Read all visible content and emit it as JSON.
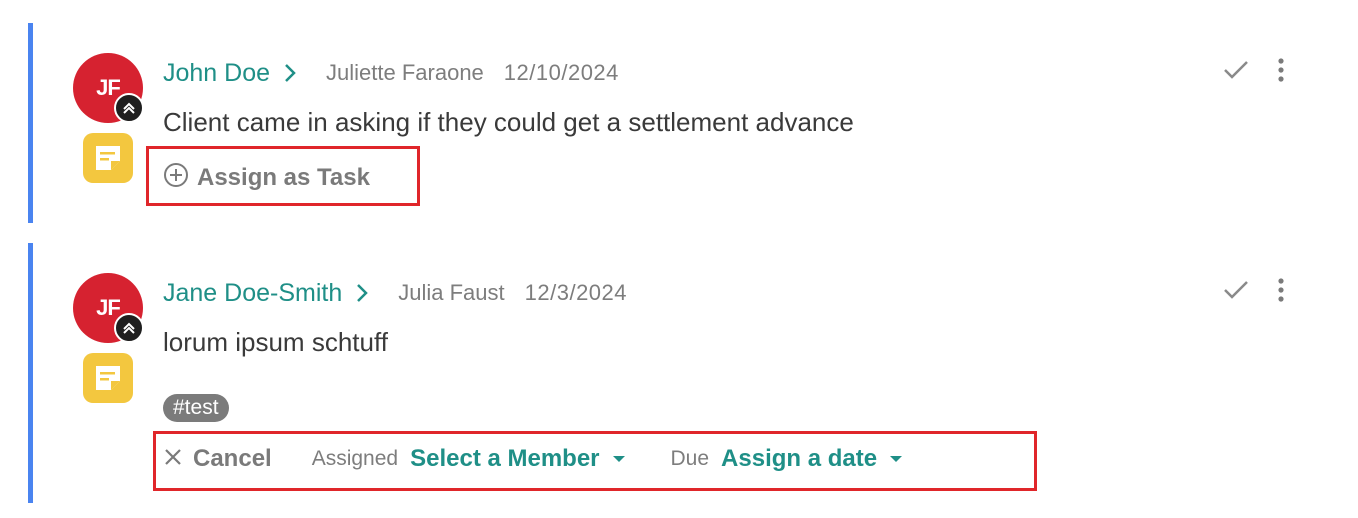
{
  "colors": {
    "accent_teal": "#1f8f87",
    "note_border": "#4a84f0",
    "avatar_bg": "#d62230",
    "note_icon_bg": "#f3c73f",
    "highlight": "#e0262a"
  },
  "notes": [
    {
      "avatar_initials": "JF",
      "avatar_badge_icon": "double-chevron-up-icon",
      "type_icon": "sticky-note-icon",
      "client_name": "John Doe",
      "author": "Juliette Faraone",
      "date": "12/10/2024",
      "body": "Client came in asking if they could get a settlement advance",
      "assign_task_label": "Assign as Task",
      "actions": [
        "check-icon",
        "more-vertical-icon"
      ]
    },
    {
      "avatar_initials": "JF",
      "avatar_badge_icon": "double-chevron-up-icon",
      "type_icon": "sticky-note-icon",
      "client_name": "Jane Doe-Smith",
      "author": "Julia Faust",
      "date": "12/3/2024",
      "body": "lorum ipsum schtuff",
      "tag": "#test",
      "task_form": {
        "cancel_label": "Cancel",
        "assigned_label": "Assigned",
        "assigned_value": "Select a Member",
        "due_label": "Due",
        "due_value": "Assign a date"
      },
      "actions": [
        "check-icon",
        "more-vertical-icon"
      ]
    }
  ]
}
